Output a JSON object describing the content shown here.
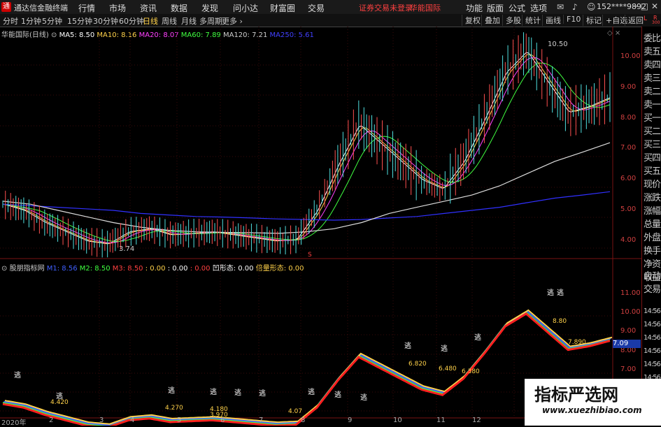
{
  "app": {
    "title": "通达信金融终端",
    "logo_char": "通"
  },
  "menu": [
    "行情",
    "市场",
    "资讯",
    "数据",
    "发现",
    "问小达",
    "财富圈",
    "交易"
  ],
  "warning": {
    "text": "证券交易未登录",
    "broker": "华能国际"
  },
  "menu_right": [
    "功能",
    "版面",
    "公式",
    "选项"
  ],
  "account": "152****9892",
  "toolbar": {
    "periods": [
      "分时",
      "1分钟",
      "5分钟",
      "15分钟",
      "30分钟",
      "60分钟",
      "日线",
      "周线",
      "月线",
      "多周期",
      "更多"
    ],
    "active": "日线",
    "right": [
      "复权",
      "叠加",
      "多股",
      "统计",
      "画线",
      "F10",
      "标记",
      "+自选",
      "返回"
    ]
  },
  "main_chart": {
    "stock": "华能国际(日线)",
    "ma": [
      {
        "label": "MA5: 8.50",
        "color": "#ffffff"
      },
      {
        "label": "MA10: 8.16",
        "color": "#ffd24a"
      },
      {
        "label": "MA20: 8.07",
        "color": "#ff40ff"
      },
      {
        "label": "MA60: 7.89",
        "color": "#40ff40"
      },
      {
        "label": "MA120: 7.21",
        "color": "#cccccc"
      },
      {
        "label": "MA250: 5.61",
        "color": "#4040ff"
      }
    ],
    "high_label": "10.50",
    "low_label": "3.74",
    "s_marker": "S"
  },
  "sub_chart": {
    "name": "股朋指标网",
    "items": [
      {
        "label": "M1: 8.56",
        "color": "#4060ff"
      },
      {
        "label": "M2: 8.50",
        "color": "#40ff40"
      },
      {
        "label": "M3: 8.50",
        "color": "#ff4040"
      },
      {
        "label": ": 0.00",
        "color": "#ffd24a"
      },
      {
        "label": ": 0.00",
        "color": "#ffffff"
      },
      {
        "label": ": 0.00",
        "color": "#ff4040"
      },
      {
        "label": "凹形态: 0.00",
        "color": "#ffffff"
      },
      {
        "label": "倍量形态: 0.00",
        "color": "#ffd24a"
      }
    ],
    "escape_label": "逃",
    "value_labels": [
      "4.420",
      "4.270",
      "4.180",
      "3.970",
      "4.07",
      "6.820",
      "6.480",
      "6.380",
      "8.80",
      "7.890"
    ],
    "current_value": "7.09"
  },
  "right_panel": [
    "委比",
    "卖五",
    "卖四",
    "卖三",
    "卖二",
    "卖一",
    "买一",
    "买二",
    "买三",
    "买四",
    "买五",
    "现价",
    "涨跌",
    "涨幅",
    "总量",
    "外盘",
    "换手",
    "净资",
    "收益",
    "自动",
    "交易"
  ],
  "right_times": [
    "14:56",
    "14:56",
    "14:56",
    "14:56",
    "14:56",
    "14:56",
    "14:56"
  ],
  "corner": {
    "l": "L",
    "r": "R",
    "sub": "300"
  },
  "y_main": [
    "10.00",
    "9.00",
    "8.00",
    "7.00",
    "6.00",
    "5.00",
    "4.00"
  ],
  "y_sub": [
    "11.00",
    "10.00",
    "9.00",
    "8.00",
    "7.00",
    "6.00",
    "5.00"
  ],
  "x_labels": [
    "2020年",
    "2",
    "3",
    "4",
    "5",
    "6",
    "7",
    "8",
    "9",
    "10",
    "11",
    "12"
  ],
  "watermark": {
    "title": "指标严选网",
    "url": "www.xuezhibiao.com"
  },
  "chart_data": {
    "type": "line",
    "series": [
      {
        "name": "MA250",
        "values": [
          5.2,
          5.15,
          5.1,
          5.05,
          5.0,
          4.9,
          4.85,
          4.8,
          4.78,
          4.75,
          4.72,
          4.7,
          4.68,
          4.7,
          4.75,
          4.8,
          4.9,
          5.0,
          5.1,
          5.25,
          5.4,
          5.5,
          5.61
        ]
      },
      {
        "name": "MA120",
        "values": [
          5.3,
          5.2,
          5.0,
          4.8,
          4.6,
          4.45,
          4.35,
          4.3,
          4.28,
          4.27,
          4.25,
          4.3,
          4.4,
          4.6,
          4.9,
          5.1,
          5.3,
          5.5,
          5.8,
          6.2,
          6.6,
          6.9,
          7.21
        ]
      }
    ],
    "close": [
      5.2,
      5.0,
      4.6,
      4.3,
      4.0,
      3.9,
      4.3,
      4.4,
      4.2,
      4.25,
      4.3,
      4.2,
      4.1,
      4.0,
      4.05,
      5.0,
      6.5,
      7.8,
      7.2,
      6.6,
      6.0,
      5.7,
      6.6,
      8.0,
      9.5,
      10.2,
      9.2,
      8.2,
      8.4,
      8.7
    ]
  }
}
